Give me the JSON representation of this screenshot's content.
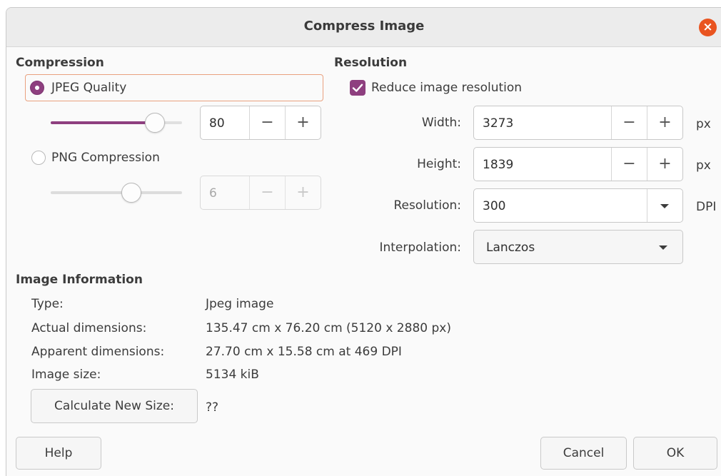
{
  "window": {
    "title": "Compress Image",
    "close_glyph": "×"
  },
  "compression": {
    "heading": "Compression",
    "jpeg": {
      "label": "JPEG Quality",
      "selected": true,
      "value": "80",
      "slider_fraction": 0.8
    },
    "png": {
      "label": "PNG Compression",
      "selected": false,
      "value": "6",
      "slider_fraction": 0.67
    },
    "minus": "−",
    "plus": "+"
  },
  "resolution": {
    "heading": "Resolution",
    "reduce_label": "Reduce image resolution",
    "reduce_checked": true,
    "width": {
      "label": "Width:",
      "value": "3273",
      "unit": "px"
    },
    "height": {
      "label": "Height:",
      "value": "1839",
      "unit": "px"
    },
    "resolution": {
      "label": "Resolution:",
      "value": "300",
      "unit": "DPI"
    },
    "interpolation": {
      "label": "Interpolation:",
      "value": "Lanczos"
    }
  },
  "info": {
    "heading": "Image Information",
    "type_label": "Type:",
    "type_value": "Jpeg image",
    "actual_label": "Actual dimensions:",
    "actual_value": "135.47 cm x 76.20 cm (5120 x 2880 px)",
    "apparent_label": "Apparent dimensions:",
    "apparent_value": "27.70 cm x 15.58 cm at 469 DPI",
    "size_label": "Image size:",
    "size_value": "5134 kiB",
    "calculate_label": "Calculate New Size:",
    "new_size_value": "??"
  },
  "buttons": {
    "help": "Help",
    "cancel": "Cancel",
    "ok": "OK"
  },
  "colors": {
    "accent": "#8e3f7f",
    "close": "#e95420",
    "focus": "#e9a17f"
  }
}
